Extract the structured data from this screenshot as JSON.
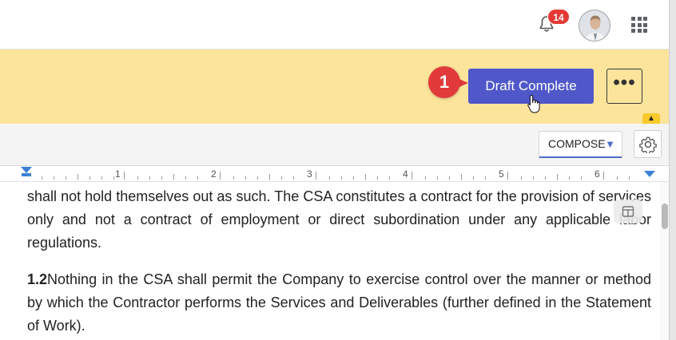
{
  "header": {
    "notifications_count": "14",
    "bell_icon": "bell-icon",
    "avatar_icon": "user-avatar",
    "apps_icon": "apps-grid-icon"
  },
  "banner": {
    "step_number": "1",
    "primary_button": "Draft Complete",
    "more_button": "•••",
    "collapse_icon": "chevron-up-icon",
    "background_color": "#fde49b",
    "button_color": "#4f57c9",
    "step_color": "#e23a3a"
  },
  "toolbar": {
    "mode_select": "COMPOSE",
    "settings_icon": "gear-icon"
  },
  "ruler": {
    "numbers": [
      "1",
      "2",
      "3",
      "4",
      "5",
      "6"
    ]
  },
  "document": {
    "paragraph_1": "shall not hold themselves out as such. The CSA constitutes a contract for the provision of services only and not a contract of employment or direct subordination under any applicable labor regulations.",
    "paragraph_2_number": "1.2",
    "paragraph_2_text": "Nothing in the CSA shall permit the Company to exercise control over the manner or method by which the Contractor performs the Services and Deliverables (further defined in the Statement of Work)."
  }
}
